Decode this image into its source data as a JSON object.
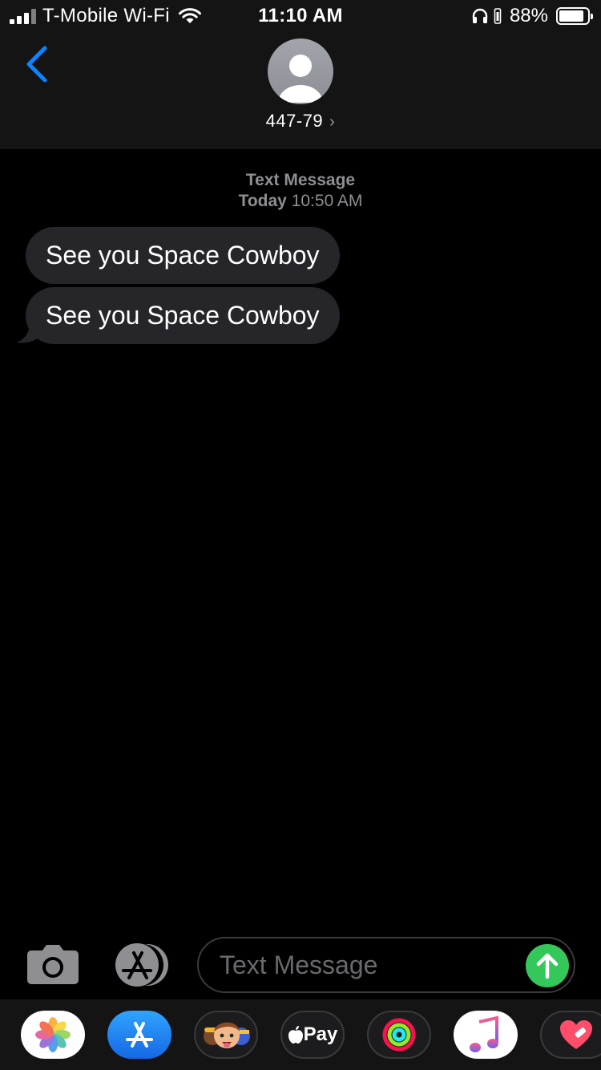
{
  "status_bar": {
    "carrier": "T-Mobile Wi-Fi",
    "time": "11:10 AM",
    "battery_percent": "88%",
    "battery_level": 0.88
  },
  "header": {
    "contact": "447-79",
    "back_icon": "chevron-left-icon",
    "avatar_icon": "person-silhouette-icon"
  },
  "thread": {
    "service_label": "Text Message",
    "day": "Today",
    "time": "10:50 AM",
    "messages": [
      {
        "text": "See you Space Cowboy",
        "direction": "received"
      },
      {
        "text": "See you Space Cowboy",
        "direction": "received"
      }
    ]
  },
  "composer": {
    "placeholder": "Text Message",
    "camera_icon": "camera-icon",
    "apps_icon": "app-store-icon",
    "send_icon": "arrow-up-icon"
  },
  "app_drawer": {
    "apps": [
      {
        "name": "photos-app",
        "icon": "photos-icon"
      },
      {
        "name": "app-store-app",
        "icon": "app-store-icon"
      },
      {
        "name": "memoji-app",
        "icon": "memoji-icon"
      },
      {
        "name": "apple-pay-app",
        "label": "Pay"
      },
      {
        "name": "activity-app",
        "icon": "activity-rings-icon"
      },
      {
        "name": "music-app",
        "icon": "music-note-icon"
      },
      {
        "name": "digital-touch-app",
        "icon": "heart-icon"
      }
    ]
  },
  "colors": {
    "accent_blue": "#0a84ff",
    "bubble_gray": "#26262a",
    "send_green": "#34c759",
    "header_bg": "#141414"
  }
}
